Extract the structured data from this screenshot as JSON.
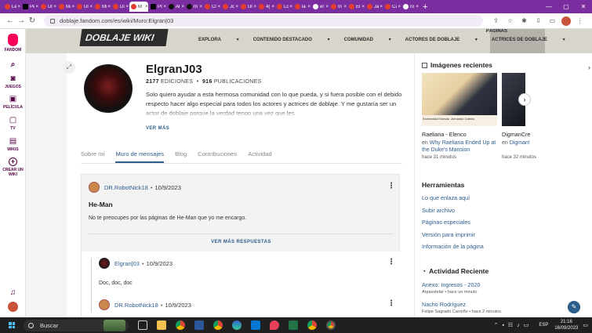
{
  "browser": {
    "tabs": [
      {
        "label": "Le",
        "icon": "youtube-icon"
      },
      {
        "label": "Pe",
        "icon": "x-icon"
      },
      {
        "label": "Ul",
        "icon": "youtube-icon"
      },
      {
        "label": "Ma",
        "icon": "youtube-icon"
      },
      {
        "label": "Ul",
        "icon": "youtube-icon"
      },
      {
        "label": "Mu",
        "icon": "youtube-icon"
      },
      {
        "label": "Di",
        "icon": "youtube-icon"
      },
      {
        "label": "M",
        "icon": "fandom-icon",
        "active": true
      },
      {
        "label": "Pc",
        "icon": "x-icon"
      },
      {
        "label": "Al",
        "icon": "tiktok-icon"
      },
      {
        "label": "m",
        "icon": "tiktok-icon"
      },
      {
        "label": "Cl",
        "icon": "youtube-icon"
      },
      {
        "label": "Jc",
        "icon": "youtube-icon"
      },
      {
        "label": "Ul",
        "icon": "youtube-icon"
      },
      {
        "label": "4(",
        "icon": "youtube-icon"
      },
      {
        "label": "Lc",
        "icon": "youtube-icon"
      },
      {
        "label": "la",
        "icon": "youtube-icon"
      },
      {
        "label": "er",
        "icon": "google-icon"
      },
      {
        "label": "In",
        "icon": "youtube-icon"
      },
      {
        "label": "El",
        "icon": "youtube-icon"
      },
      {
        "label": "Ja",
        "icon": "youtube-icon"
      },
      {
        "label": "Ca",
        "icon": "youtube-icon"
      },
      {
        "label": "ro",
        "icon": "google-icon"
      }
    ],
    "url": "doblaje.fandom.com/es/wiki/Muro:Elgran|03"
  },
  "rail": {
    "items": [
      {
        "label": "FANDOM",
        "icon": "fandom-logo-icon"
      },
      {
        "label": "JUEGOS",
        "icon": "gamepad-icon"
      },
      {
        "label": "PELÍCULA",
        "icon": "film-icon"
      },
      {
        "label": "TV",
        "icon": "tv-icon"
      },
      {
        "label": "WIKIS",
        "icon": "book-icon"
      },
      {
        "label": "CREAR UN WIKI",
        "icon": "plus-circle-icon"
      }
    ]
  },
  "wiki": {
    "art_text": "DOBLAJE WIKI",
    "nav": [
      "Explora",
      "Contenido destacado",
      "Comunidad",
      "Actores de doblaje",
      "Actrices de doblaje"
    ],
    "paginas": "PÁGINAS"
  },
  "profile": {
    "username": "ElgranJ03",
    "ediciones_num": "2177",
    "ediciones_label": "EDICIONES",
    "publicaciones_num": "916",
    "publicaciones_label": "PUBLICACIONES",
    "bio": "Solo quiero ayudar a esta hermosa comunidad con lo que pueda, y si fuera posible con el debido respecto hacer algo especial para todos los actores y actrices de doblaje. Y me gustaría ser un actor de doblaje porque la verdad tengo una vez que les",
    "ver_mas": "VER MÁS"
  },
  "tabs": [
    "Sobre mí",
    "Muro de mensajes",
    "Blog",
    "Contribuciones",
    "Actividad"
  ],
  "thread": {
    "author": "DR.RobotNick18",
    "date": "10/9/2023",
    "title": "He-Man",
    "body": "No te preocupes por las páginas de He-Man que yo me encargo.",
    "more_replies": "VER MÁS RESPUESTAS",
    "replies": [
      {
        "author": "Elgran|03",
        "date": "10/9/2023",
        "body": "Doc, doc, doc"
      },
      {
        "author": "DR.RobotNick18",
        "date": "10/9/2023"
      }
    ]
  },
  "right_rail": {
    "recent_images_title": "Imágenes recientes",
    "images": [
      {
        "title": "Raeliana - Elenco",
        "prefix": "en",
        "link": "Why Raeliana Ended Up at the Duke's Mansion",
        "time": "hace 31 minutos",
        "caption_a": "Esmeralda Estrada",
        "caption_b": "Armando Cabino"
      },
      {
        "title": "DigmanCre",
        "prefix": "en",
        "link": "Digman!",
        "time": "hace 32 minutos"
      }
    ],
    "tools_title": "Herramientas",
    "tools": [
      "Lo que enlaza aquí",
      "Subir archivo",
      "Páginas especiales",
      "Versión para imprimir",
      "Información de la página"
    ],
    "activity_title": "Actividad Reciente",
    "activity": [
      {
        "title": "Anexo: Ingresos - 2020",
        "sub": "Arpasstelar • hace un minuto"
      },
      {
        "title": "Nacho Rodríguez",
        "sub": "Felipe Sagrado Carreño • hace 2 minutos"
      }
    ]
  },
  "taskbar": {
    "search_placeholder": "Buscar",
    "lang": "ESP",
    "time": "21:16",
    "date": "16/09/2023"
  }
}
